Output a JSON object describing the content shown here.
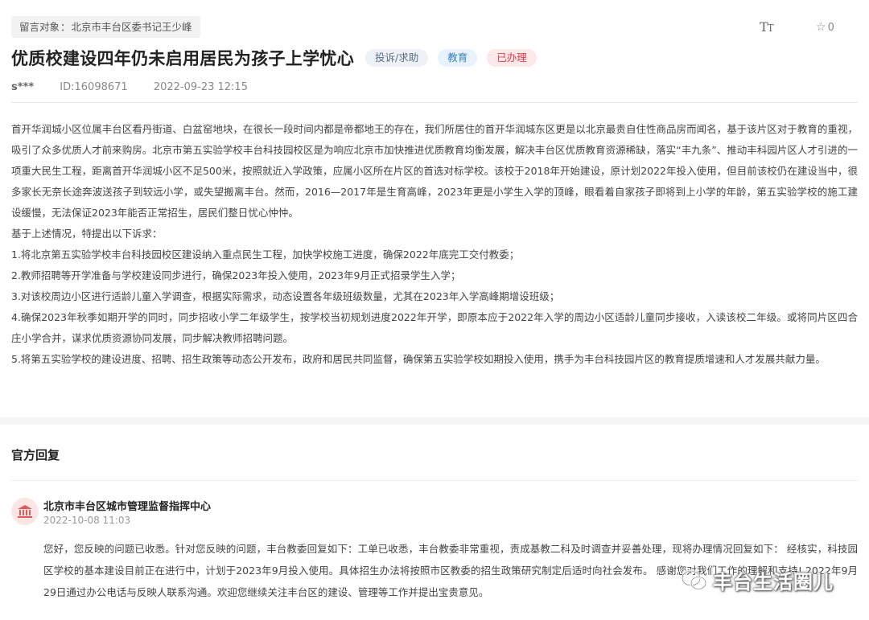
{
  "header": {
    "recipient_label": "留言对象",
    "recipient_sep": "：",
    "recipient_value": "北京市丰台区委书记王少峰",
    "font_size_icon_big": "T",
    "font_size_icon_small": "T",
    "star_count": "0"
  },
  "post": {
    "title": "优质校建设四年仍未启用居民为孩子上学忧心",
    "tags": [
      "投诉/求助",
      "教育",
      "已办理"
    ],
    "user": "s***",
    "id": "ID:16098671",
    "datetime": "2022-09-23 12:15",
    "paragraphs": [
      "首开华润城小区位属丰台区看丹街道、白盆窑地块，在很长一段时间内都是帝都地王的存在，我们所居住的首开华润城东区更是以北京最贵自住性商品房而闻名，基于该片区对于教育的重视，吸引了众多优质人才前来购房。北京市第五实验学校丰台科技园校区是为响应北京市加快推进优质教育均衡发展，解决丰台区优质教育资源稀缺，落实“丰九条”、推动丰科园片区人才引进的一项重大民生工程，距离首开华润城小区不足500米，按照就近入学政策，应属小区所在片区的首选对标学校。该校于2018年开始建设，原计划2022年投入使用，但目前该校仍在建设当中，很多家长无奈长途奔波送孩子到较远小学，或失望搬离丰台。然而，2016—2017年是生育高峰，2023年更是小学生入学的顶峰，眼看着自家孩子即将到上小学的年龄，第五实验学校的施工建设缓慢，无法保证2023年能否正常招生，居民们整日忧心忡忡。",
      "基于上述情况，特提出以下诉求：",
      "1.将北京第五实验学校丰台科技园校区建设纳入重点民生工程，加快学校施工进度，确保2022年底完工交付教委；",
      "2.教师招聘等开学准备与学校建设同步进行，确保2023年投入使用，2023年9月正式招录学生入学；",
      "3.对该校周边小区进行适龄儿童入学调查，根据实际需求，动态设置各年级班级数量，尤其在2023年入学高峰期增设班级；",
      "4.确保2023年秋季如期开学的同时，同步招收小学二年级学生，按学校当初规划进度2022年开学，即原本应于2022年入学的周边小区适龄儿童同步接收，入读该校二年级。或将同片区四合庄小学合并，谋求优质资源协同发展，同步解决教师招聘问题。",
      "5.将第五实验学校的建设进度、招聘、招生政策等动态公开发布，政府和居民共同监督，确保第五实验学校如期投入使用，携手为丰台科技园片区的教育提质增速和人才发展共献力量。"
    ]
  },
  "official": {
    "section_title": "官方回复",
    "org_name": "北京市丰台区城市管理监督指挥中心",
    "date": "2022-10-08 11:03",
    "reply_text": "您好，您反映的问题已收悉。针对您反映的问题，丰台教委回复如下：工单已收悉，丰台教委非常重视，责成基教二科及时调查并妥善处理，现将办理情况回复如下： 经核实，科技园区学校的基本建设目前正在进行中，计划于2023年9月投入使用。具体招生办法将按照市区教委的招生政策研究制定后适时向社会发布。 感谢您对我们工作的理解和支持! 2022年9月29日通过办公电话与反映人联系沟通。欢迎您继续关注丰台区的建设、管理等工作并提出宝贵意见。"
  },
  "watermark": {
    "text": "丰台生活圈儿",
    "icon": "wechat-icon"
  },
  "colors": {
    "tag_gray_bg": "#eef1f5",
    "tag_blue_text": "#3a7fc4",
    "tag_red_text": "#e0394b",
    "avatar_red": "#e05a5a"
  }
}
